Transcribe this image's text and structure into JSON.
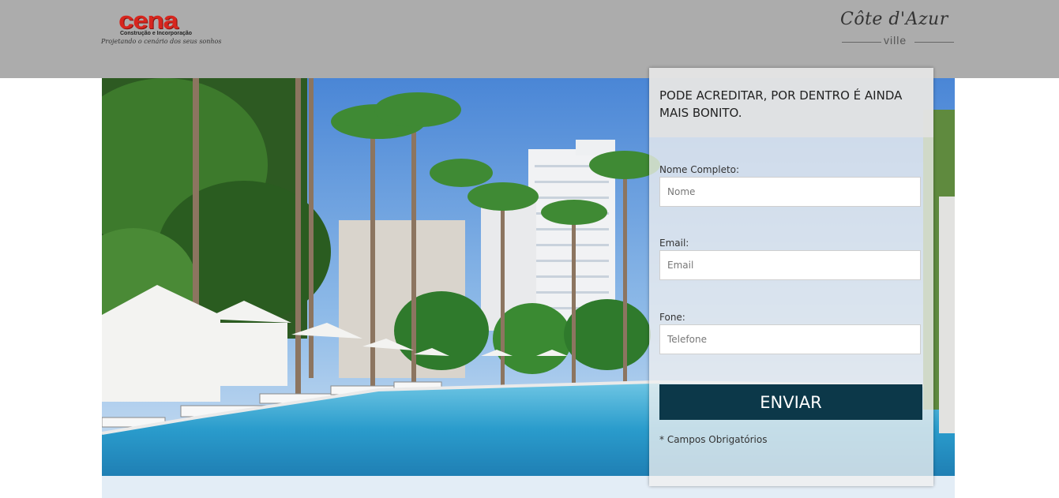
{
  "header": {
    "logo_left": {
      "brand": "cena",
      "subtitle": "Construção e Incorporação",
      "tagline": "Projetando o cenário dos seus sonhos"
    },
    "logo_right": {
      "name": "Côte d'Azur",
      "sub": "ville"
    }
  },
  "hero": {
    "image": "resort-pool-palm-trees-photo"
  },
  "form": {
    "title": "PODE ACREDITAR, POR DENTRO É AINDA MAIS BONITO.",
    "fields": [
      {
        "label": "Nome Completo:",
        "placeholder": "Nome",
        "value": ""
      },
      {
        "label": "Email:",
        "placeholder": "Email",
        "value": ""
      },
      {
        "label": "Fone:",
        "placeholder": "Telefone",
        "value": ""
      }
    ],
    "submit_label": "ENVIAR",
    "required_note": "* Campos Obrigatórios"
  },
  "colors": {
    "header_bg": "#acacac",
    "brand_red": "#d7261e",
    "button_bg": "#0c3849",
    "below_band": "#e3edf6"
  }
}
